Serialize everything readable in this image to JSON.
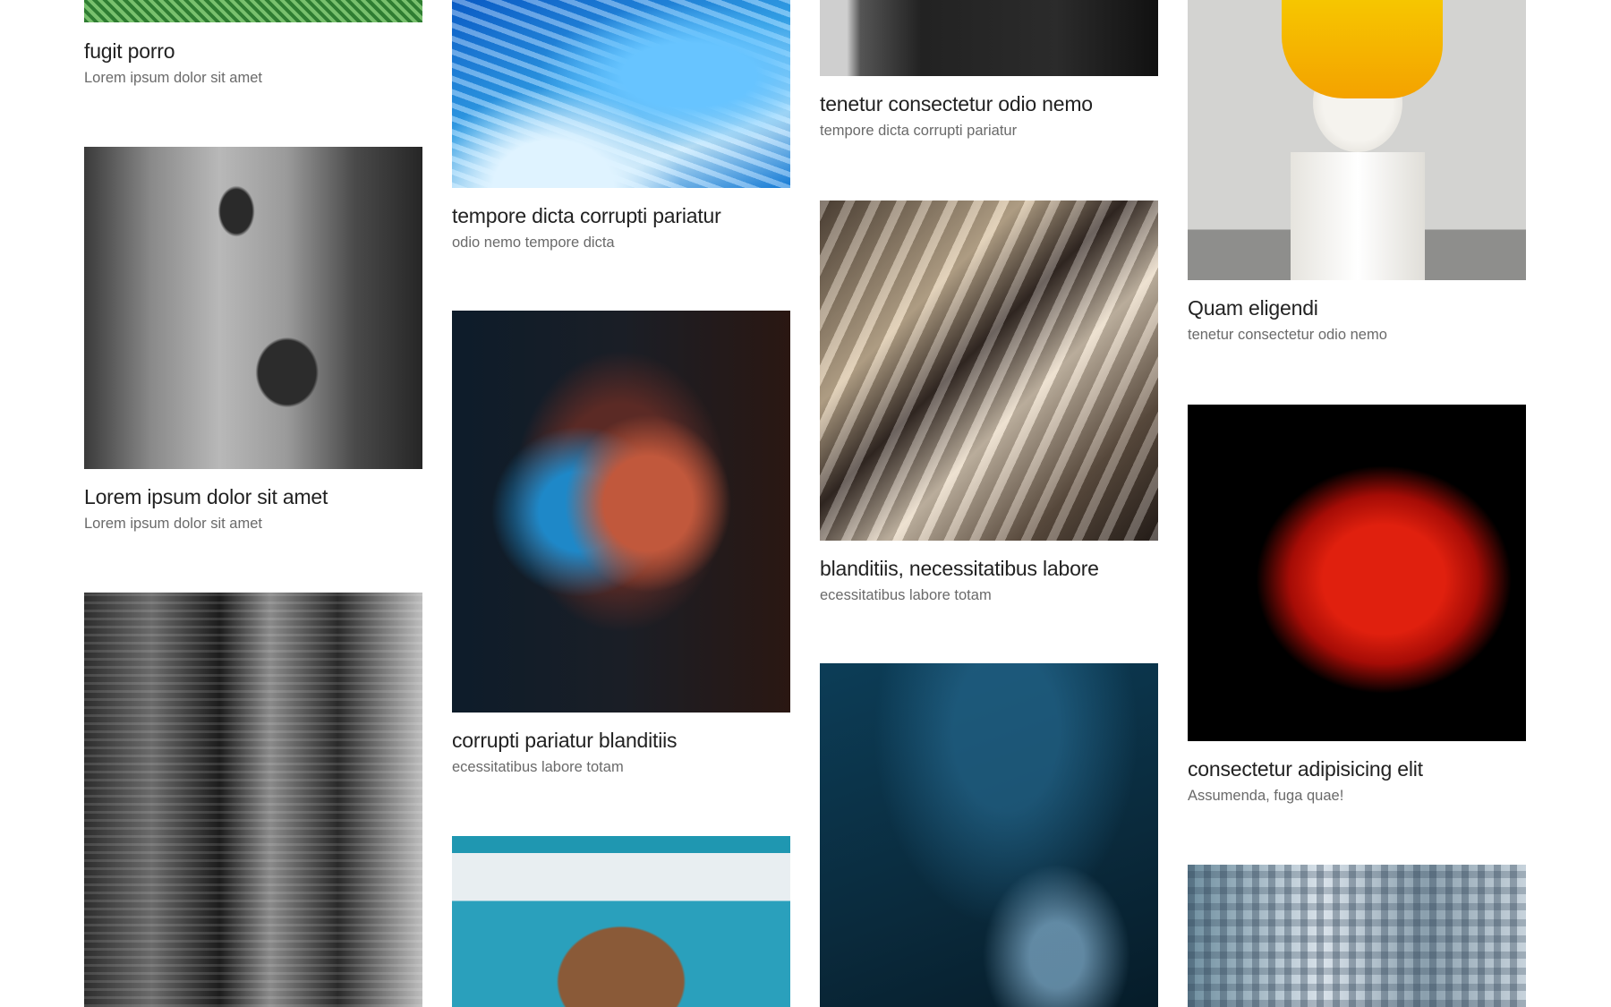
{
  "columns": [
    {
      "cards": [
        {
          "title": "fugit porro",
          "subtitle": "Lorem ipsum dolor sit amet"
        },
        {
          "title": "Lorem ipsum dolor sit amet",
          "subtitle": "Lorem ipsum dolor sit amet"
        },
        {
          "title": "",
          "subtitle": ""
        }
      ]
    },
    {
      "cards": [
        {
          "title": "tempore dicta corrupti pariatur",
          "subtitle": "odio nemo tempore dicta"
        },
        {
          "title": "corrupti pariatur blanditiis",
          "subtitle": "ecessitatibus labore totam"
        },
        {
          "title": "",
          "subtitle": ""
        }
      ]
    },
    {
      "cards": [
        {
          "title": "tenetur consectetur odio nemo",
          "subtitle": "tempore dicta corrupti pariatur"
        },
        {
          "title": "blanditiis, necessitatibus labore",
          "subtitle": "ecessitatibus labore totam"
        },
        {
          "title": "",
          "subtitle": ""
        }
      ]
    },
    {
      "cards": [
        {
          "title": "Quam eligendi",
          "subtitle": "tenetur consectetur odio nemo"
        },
        {
          "title": "consectetur adipisicing elit",
          "subtitle": "Assumenda, fuga quae!"
        },
        {
          "title": "",
          "subtitle": ""
        }
      ]
    }
  ]
}
